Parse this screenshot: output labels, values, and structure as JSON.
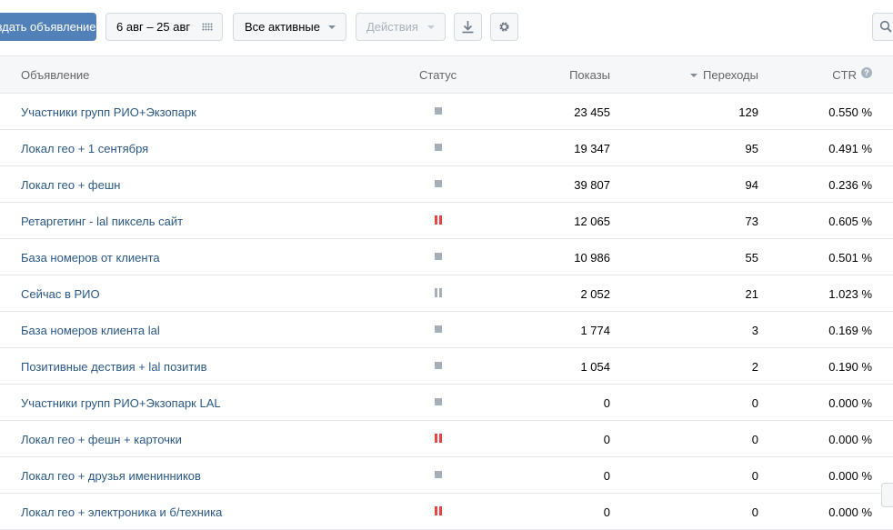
{
  "toolbar": {
    "create_label": "Создать объявление",
    "date_range": "6 авг – 25 авг",
    "filter_label": "Все активные",
    "actions_label": "Действия",
    "icons": {
      "calendar": "calendar-icon",
      "download": "download-icon",
      "settings": "gear-icon",
      "search": "search-icon"
    }
  },
  "table": {
    "headers": {
      "ad": "Объявление",
      "status": "Статус",
      "shows": "Показы",
      "clicks": "Переходы",
      "ctr": "CTR",
      "help": "?"
    },
    "rows": [
      {
        "name": "Участники групп РИО+Экзопарк",
        "status": "stopped",
        "shows": "23 455",
        "clicks": "129",
        "ctr": "0.550 %"
      },
      {
        "name": "Локал гео + 1 сентября",
        "status": "stopped",
        "shows": "19 347",
        "clicks": "95",
        "ctr": "0.491 %"
      },
      {
        "name": "Локал гео + фешн",
        "status": "stopped",
        "shows": "39 807",
        "clicks": "94",
        "ctr": "0.236 %"
      },
      {
        "name": "Ретаргетинг - lal пиксель сайт",
        "status": "paused-red",
        "shows": "12 065",
        "clicks": "73",
        "ctr": "0.605 %"
      },
      {
        "name": "База номеров от клиента",
        "status": "stopped",
        "shows": "10 986",
        "clicks": "55",
        "ctr": "0.501 %"
      },
      {
        "name": "Сейчас в РИО",
        "status": "paused-gray",
        "shows": "2 052",
        "clicks": "21",
        "ctr": "1.023 %"
      },
      {
        "name": "База номеров клиента lal",
        "status": "stopped",
        "shows": "1 774",
        "clicks": "3",
        "ctr": "0.169 %"
      },
      {
        "name": "Позитивные дествия + lal позитив",
        "status": "stopped",
        "shows": "1 054",
        "clicks": "2",
        "ctr": "0.190 %"
      },
      {
        "name": "Участники групп РИО+Экзопарк LAL",
        "status": "stopped",
        "shows": "0",
        "clicks": "0",
        "ctr": "0.000 %"
      },
      {
        "name": "Локал гео + фешн + карточки",
        "status": "paused-red",
        "shows": "0",
        "clicks": "0",
        "ctr": "0.000 %"
      },
      {
        "name": "Локал гео + друзья именинников",
        "status": "stopped",
        "shows": "0",
        "clicks": "0",
        "ctr": "0.000 %"
      },
      {
        "name": "Локал гео + электроника и б/техника",
        "status": "paused-red",
        "shows": "0",
        "clicks": "0",
        "ctr": "0.000 %"
      }
    ]
  },
  "colors": {
    "accent": "#5181b8",
    "link": "#2a5885",
    "status_stopped": "#a7afb9",
    "status_paused_red": "#e64646",
    "status_paused_gray": "#a7afb9"
  }
}
